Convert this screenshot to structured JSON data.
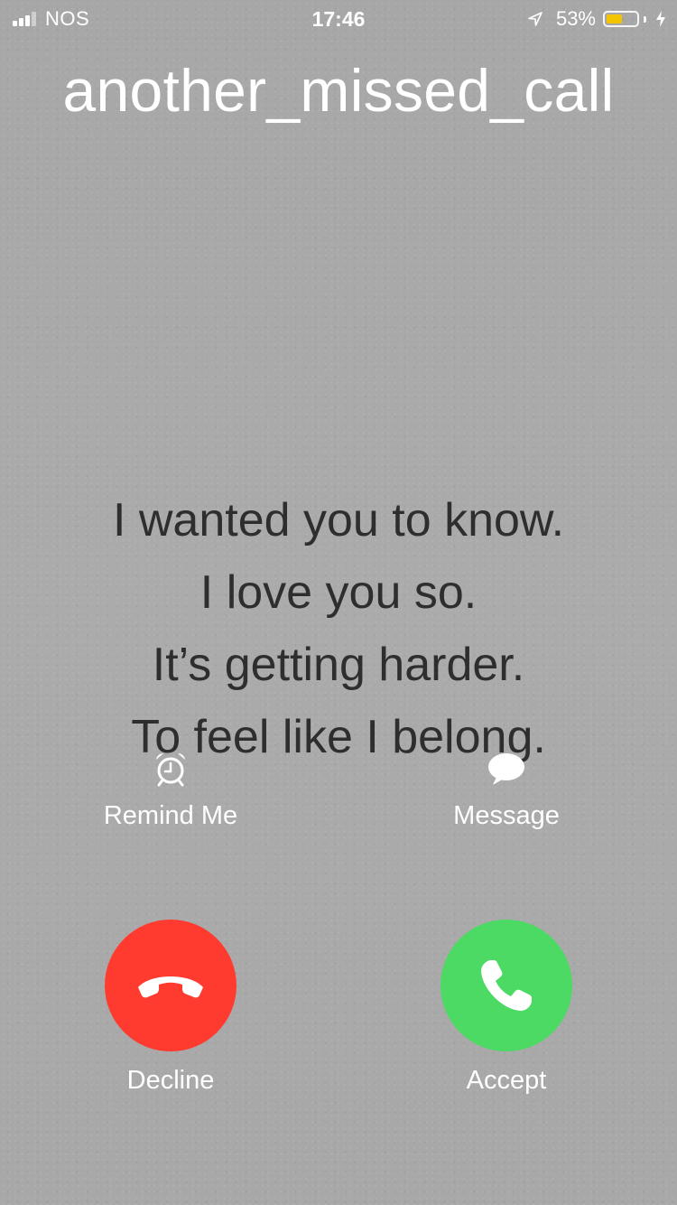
{
  "status_bar": {
    "carrier": "NOS",
    "signal_bars_filled": 3,
    "signal_bars_total": 4,
    "time": "17:46",
    "battery_percent": "53%",
    "battery_level": 0.53,
    "battery_color": "#f4c400",
    "icons": [
      "signal-icon",
      "location-arrow-icon",
      "battery-icon",
      "charging-bolt-icon"
    ]
  },
  "caller": {
    "name": "another_missed_call"
  },
  "lyrics": [
    "I wanted you to know.",
    "I love you so.",
    "It’s getting harder.",
    "To feel like I belong."
  ],
  "actions": {
    "remind": {
      "label": "Remind Me",
      "icon": "alarm-clock-icon"
    },
    "message": {
      "label": "Message",
      "icon": "speech-bubble-icon"
    },
    "decline": {
      "label": "Decline",
      "icon": "hang-up-phone-icon",
      "color": "#ff3b30"
    },
    "accept": {
      "label": "Accept",
      "icon": "phone-icon",
      "color": "#4cd964"
    }
  }
}
